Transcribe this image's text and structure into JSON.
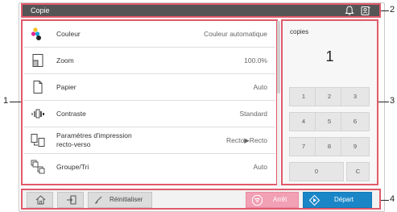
{
  "header": {
    "title": "Copie"
  },
  "settings": {
    "rows": [
      {
        "label": "Couleur",
        "value": "Couleur automatique"
      },
      {
        "label": "Zoom",
        "value": "100.0%"
      },
      {
        "label": "Papier",
        "value": "Auto"
      },
      {
        "label": "Contraste",
        "value": "Standard"
      },
      {
        "label_line1": "Paramètres d'impression",
        "label_line2": "recto-verso",
        "value": "Recto▶Recto"
      },
      {
        "label": "Groupe/Tri",
        "value": "Auto"
      }
    ]
  },
  "keypad": {
    "label": "copies",
    "value": "1",
    "keys": [
      "1",
      "2",
      "3",
      "4",
      "5",
      "6",
      "7",
      "8",
      "9",
      "0",
      "C"
    ]
  },
  "bottom": {
    "reset_label": "Réinitialiser",
    "stop_label": "Arrêt",
    "start_label": "Départ"
  },
  "callouts": [
    "1",
    "2",
    "3",
    "4"
  ],
  "colors": {
    "highlight": "#e05a6a",
    "start": "#1a86c8",
    "stop": "#f2a0b4",
    "titlebar": "#555555"
  }
}
